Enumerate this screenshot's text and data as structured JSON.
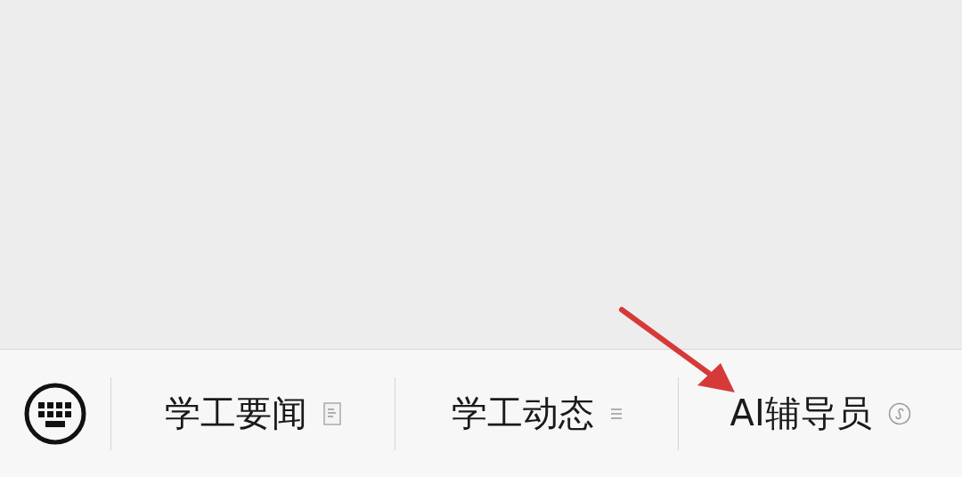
{
  "menu_bar": {
    "items": [
      {
        "label": "学工要闻",
        "kind": "article"
      },
      {
        "label": "学工动态",
        "kind": "list"
      },
      {
        "label": "AI辅导员",
        "kind": "miniprogram"
      }
    ]
  }
}
